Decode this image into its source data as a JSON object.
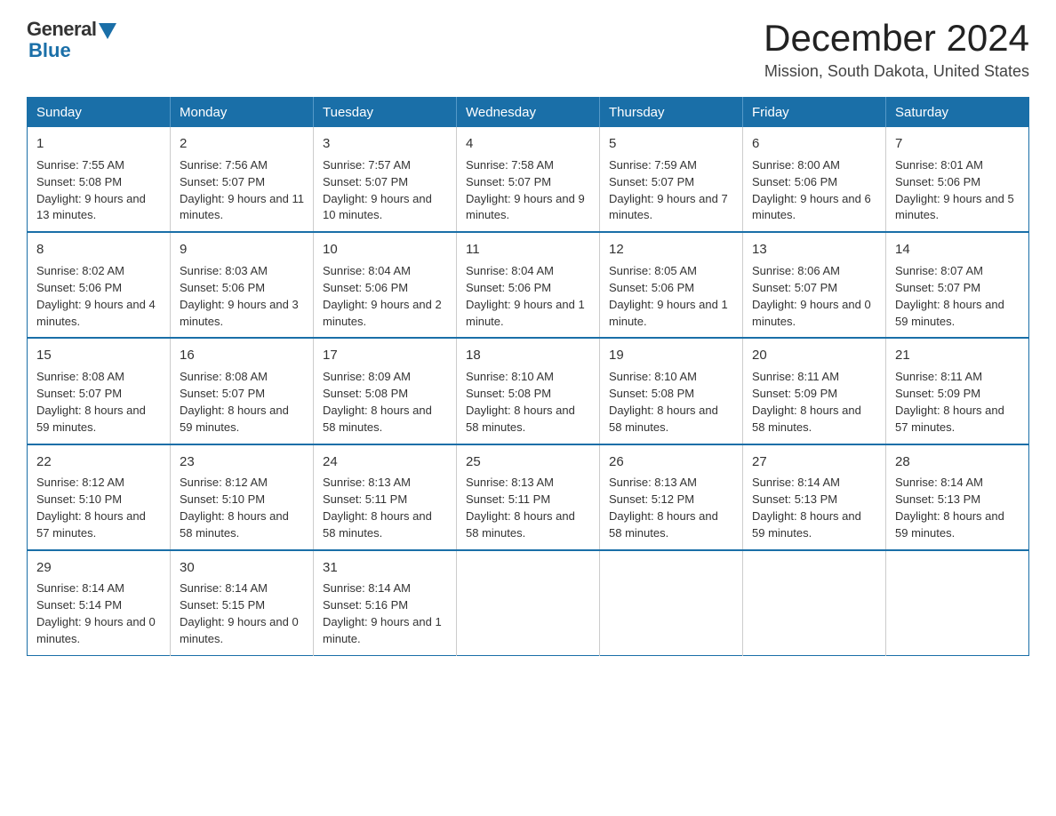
{
  "logo": {
    "general": "General",
    "blue": "Blue"
  },
  "header": {
    "month": "December 2024",
    "location": "Mission, South Dakota, United States"
  },
  "weekdays": [
    "Sunday",
    "Monday",
    "Tuesday",
    "Wednesday",
    "Thursday",
    "Friday",
    "Saturday"
  ],
  "weeks": [
    [
      {
        "day": "1",
        "sunrise": "7:55 AM",
        "sunset": "5:08 PM",
        "daylight": "9 hours and 13 minutes."
      },
      {
        "day": "2",
        "sunrise": "7:56 AM",
        "sunset": "5:07 PM",
        "daylight": "9 hours and 11 minutes."
      },
      {
        "day": "3",
        "sunrise": "7:57 AM",
        "sunset": "5:07 PM",
        "daylight": "9 hours and 10 minutes."
      },
      {
        "day": "4",
        "sunrise": "7:58 AM",
        "sunset": "5:07 PM",
        "daylight": "9 hours and 9 minutes."
      },
      {
        "day": "5",
        "sunrise": "7:59 AM",
        "sunset": "5:07 PM",
        "daylight": "9 hours and 7 minutes."
      },
      {
        "day": "6",
        "sunrise": "8:00 AM",
        "sunset": "5:06 PM",
        "daylight": "9 hours and 6 minutes."
      },
      {
        "day": "7",
        "sunrise": "8:01 AM",
        "sunset": "5:06 PM",
        "daylight": "9 hours and 5 minutes."
      }
    ],
    [
      {
        "day": "8",
        "sunrise": "8:02 AM",
        "sunset": "5:06 PM",
        "daylight": "9 hours and 4 minutes."
      },
      {
        "day": "9",
        "sunrise": "8:03 AM",
        "sunset": "5:06 PM",
        "daylight": "9 hours and 3 minutes."
      },
      {
        "day": "10",
        "sunrise": "8:04 AM",
        "sunset": "5:06 PM",
        "daylight": "9 hours and 2 minutes."
      },
      {
        "day": "11",
        "sunrise": "8:04 AM",
        "sunset": "5:06 PM",
        "daylight": "9 hours and 1 minute."
      },
      {
        "day": "12",
        "sunrise": "8:05 AM",
        "sunset": "5:06 PM",
        "daylight": "9 hours and 1 minute."
      },
      {
        "day": "13",
        "sunrise": "8:06 AM",
        "sunset": "5:07 PM",
        "daylight": "9 hours and 0 minutes."
      },
      {
        "day": "14",
        "sunrise": "8:07 AM",
        "sunset": "5:07 PM",
        "daylight": "8 hours and 59 minutes."
      }
    ],
    [
      {
        "day": "15",
        "sunrise": "8:08 AM",
        "sunset": "5:07 PM",
        "daylight": "8 hours and 59 minutes."
      },
      {
        "day": "16",
        "sunrise": "8:08 AM",
        "sunset": "5:07 PM",
        "daylight": "8 hours and 59 minutes."
      },
      {
        "day": "17",
        "sunrise": "8:09 AM",
        "sunset": "5:08 PM",
        "daylight": "8 hours and 58 minutes."
      },
      {
        "day": "18",
        "sunrise": "8:10 AM",
        "sunset": "5:08 PM",
        "daylight": "8 hours and 58 minutes."
      },
      {
        "day": "19",
        "sunrise": "8:10 AM",
        "sunset": "5:08 PM",
        "daylight": "8 hours and 58 minutes."
      },
      {
        "day": "20",
        "sunrise": "8:11 AM",
        "sunset": "5:09 PM",
        "daylight": "8 hours and 58 minutes."
      },
      {
        "day": "21",
        "sunrise": "8:11 AM",
        "sunset": "5:09 PM",
        "daylight": "8 hours and 57 minutes."
      }
    ],
    [
      {
        "day": "22",
        "sunrise": "8:12 AM",
        "sunset": "5:10 PM",
        "daylight": "8 hours and 57 minutes."
      },
      {
        "day": "23",
        "sunrise": "8:12 AM",
        "sunset": "5:10 PM",
        "daylight": "8 hours and 58 minutes."
      },
      {
        "day": "24",
        "sunrise": "8:13 AM",
        "sunset": "5:11 PM",
        "daylight": "8 hours and 58 minutes."
      },
      {
        "day": "25",
        "sunrise": "8:13 AM",
        "sunset": "5:11 PM",
        "daylight": "8 hours and 58 minutes."
      },
      {
        "day": "26",
        "sunrise": "8:13 AM",
        "sunset": "5:12 PM",
        "daylight": "8 hours and 58 minutes."
      },
      {
        "day": "27",
        "sunrise": "8:14 AM",
        "sunset": "5:13 PM",
        "daylight": "8 hours and 59 minutes."
      },
      {
        "day": "28",
        "sunrise": "8:14 AM",
        "sunset": "5:13 PM",
        "daylight": "8 hours and 59 minutes."
      }
    ],
    [
      {
        "day": "29",
        "sunrise": "8:14 AM",
        "sunset": "5:14 PM",
        "daylight": "9 hours and 0 minutes."
      },
      {
        "day": "30",
        "sunrise": "8:14 AM",
        "sunset": "5:15 PM",
        "daylight": "9 hours and 0 minutes."
      },
      {
        "day": "31",
        "sunrise": "8:14 AM",
        "sunset": "5:16 PM",
        "daylight": "9 hours and 1 minute."
      },
      null,
      null,
      null,
      null
    ]
  ]
}
